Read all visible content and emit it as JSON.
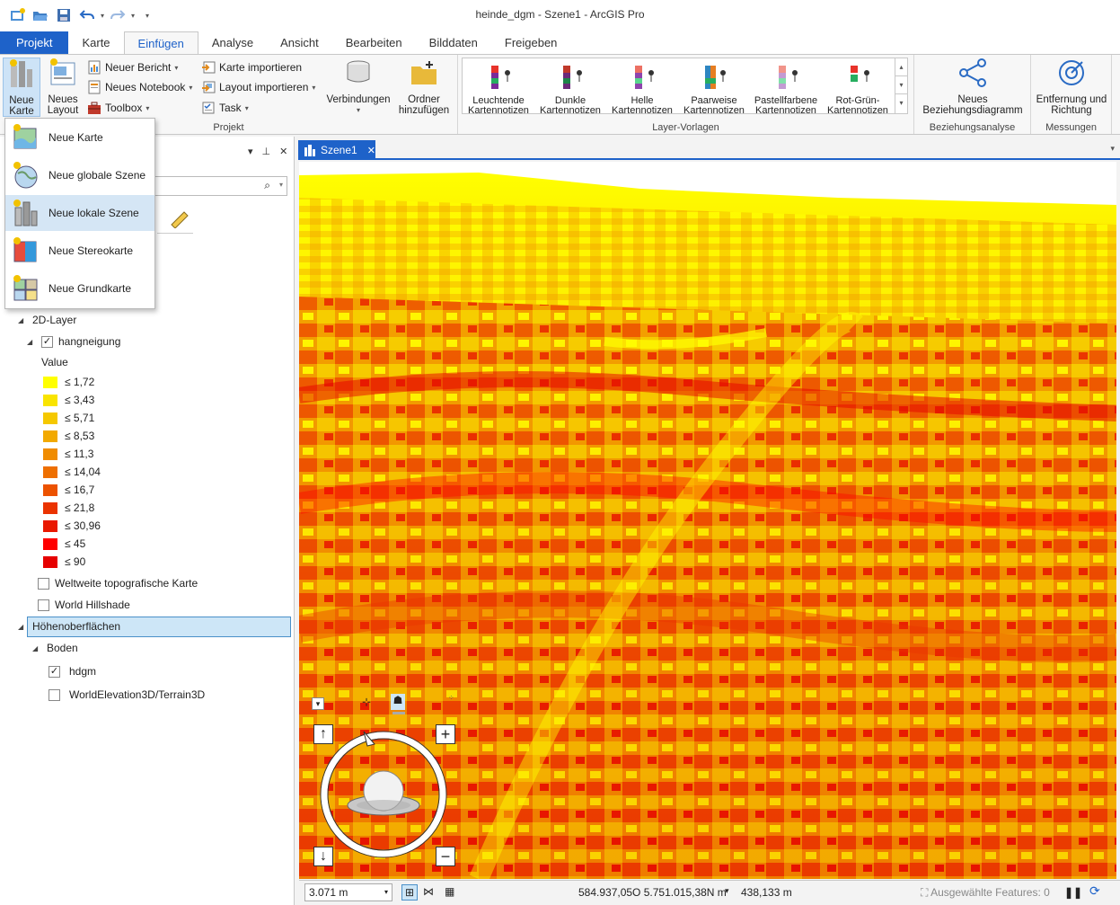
{
  "window": {
    "title": "heinde_dgm - Szene1 - ArcGIS Pro"
  },
  "tabs": [
    {
      "label": "Projekt"
    },
    {
      "label": "Karte"
    },
    {
      "label": "Einfügen"
    },
    {
      "label": "Analyse"
    },
    {
      "label": "Ansicht"
    },
    {
      "label": "Bearbeiten"
    },
    {
      "label": "Bilddaten"
    },
    {
      "label": "Freigeben"
    }
  ],
  "ribbon": {
    "projekt": {
      "neue_karte": "Neue Karte",
      "neues_layout": "Neues Layout",
      "neuer_bericht": "Neuer Bericht",
      "neues_notebook": "Neues Notebook",
      "toolbox": "Toolbox",
      "karte_importieren": "Karte importieren",
      "layout_importieren": "Layout importieren",
      "task": "Task",
      "verbindungen": "Verbindungen",
      "ordner_hinzufuegen": "Ordner hinzufügen",
      "group_label": "Projekt"
    },
    "layer_vorlagen": {
      "items": [
        {
          "line1": "Leuchtende",
          "line2": "Kartennotizen"
        },
        {
          "line1": "Dunkle",
          "line2": "Kartennotizen"
        },
        {
          "line1": "Helle",
          "line2": "Kartennotizen"
        },
        {
          "line1": "Paarweise",
          "line2": "Kartennotizen"
        },
        {
          "line1": "Pastellfarbene",
          "line2": "Kartennotizen"
        },
        {
          "line1": "Rot-Grün-",
          "line2": "Kartennotizen"
        }
      ],
      "group_label": "Layer-Vorlagen"
    },
    "beziehung": {
      "btn": "Neues Beziehungsdiagramm",
      "group_label": "Beziehungsanalyse"
    },
    "messungen": {
      "btn": "Entfernung und Richtung",
      "group_label": "Messungen"
    }
  },
  "dropdown": {
    "items": [
      {
        "label": "Neue Karte"
      },
      {
        "label": "Neue globale Szene"
      },
      {
        "label": "Neue lokale Szene"
      },
      {
        "label": "Neue Stereokarte"
      },
      {
        "label": "Neue Grundkarte"
      }
    ]
  },
  "contents": {
    "layers_2d": "2D-Layer",
    "hangneigung": "hangneigung",
    "value_label": "Value",
    "legend": [
      {
        "label": "≤ 1,72",
        "color": "#ffff00"
      },
      {
        "label": "≤ 3,43",
        "color": "#f9e400"
      },
      {
        "label": "≤ 5,71",
        "color": "#f5c800"
      },
      {
        "label": "≤ 8,53",
        "color": "#f2a900"
      },
      {
        "label": "≤ 11,3",
        "color": "#f08c00"
      },
      {
        "label": "≤ 14,04",
        "color": "#ee6f00"
      },
      {
        "label": "≤ 16,7",
        "color": "#ec5200"
      },
      {
        "label": "≤ 21,8",
        "color": "#ea3300"
      },
      {
        "label": "≤ 30,96",
        "color": "#e91800"
      },
      {
        "label": "≤ 45",
        "color": "#ff0000"
      },
      {
        "label": "≤ 90",
        "color": "#e60000"
      }
    ],
    "weltweite": "Weltweite topografische Karte",
    "hillshade": "World Hillshade",
    "hoehenoberflaechen": "Höhenoberflächen",
    "boden": "Boden",
    "hdgm": "hdgm",
    "worldelevation": "WorldElevation3D/Terrain3D"
  },
  "view": {
    "tab_label": "Szene1"
  },
  "statusbar": {
    "scale": "3.071 m",
    "coords": "584.937,05O 5.751.015,38N m",
    "elevation": "438,133 m",
    "selected": "Ausgewählte Features: 0"
  }
}
